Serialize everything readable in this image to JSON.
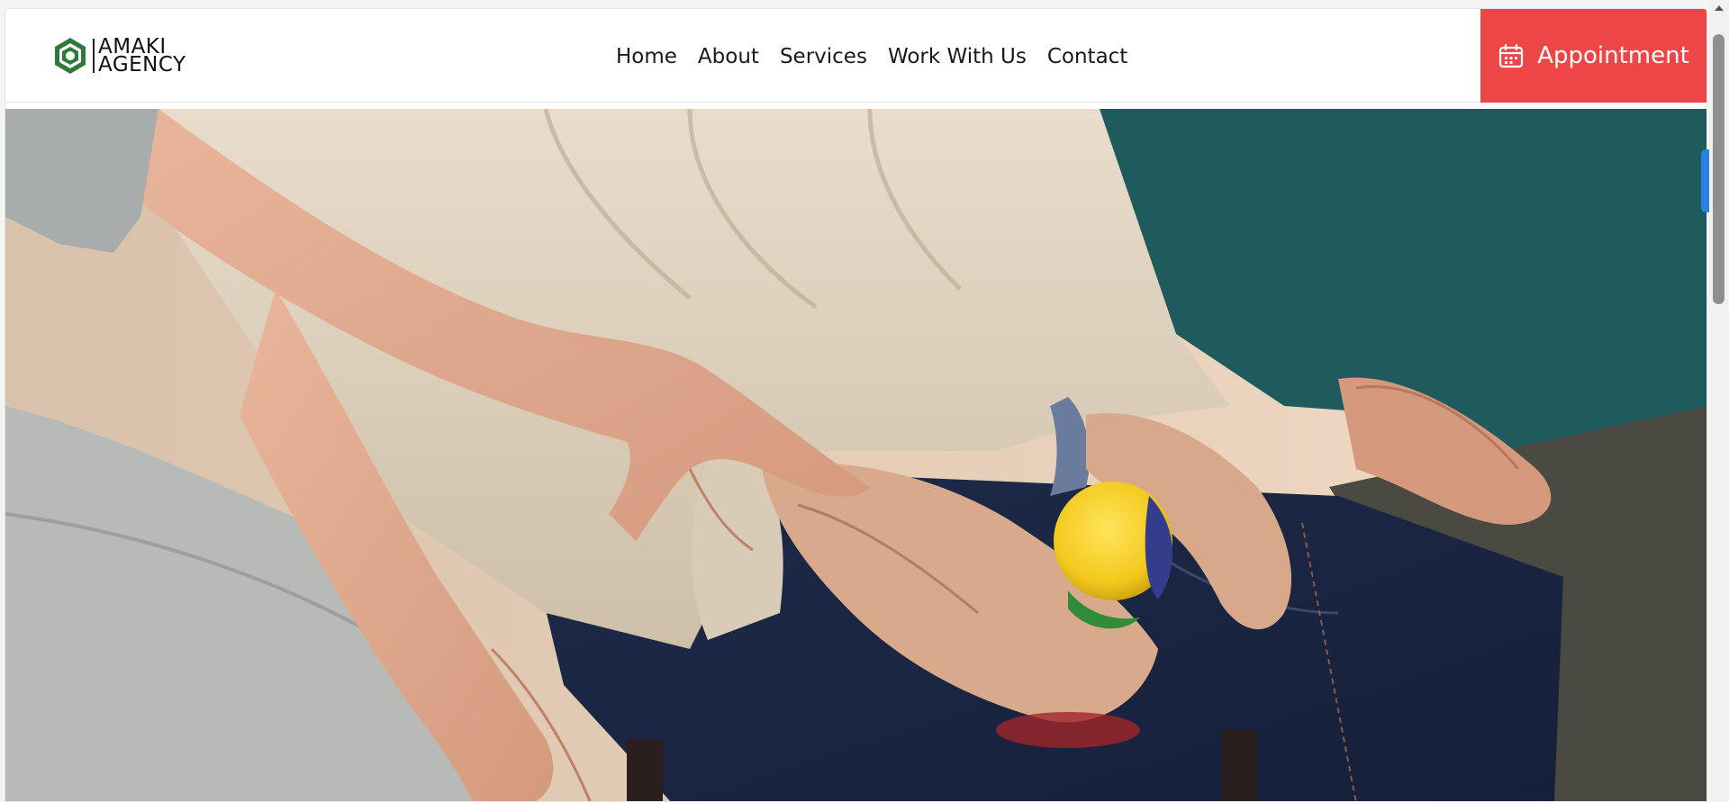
{
  "logo": {
    "line1": "AMAKI",
    "line2": "AGENCY",
    "mark_color": "#2f7a3a"
  },
  "nav": {
    "items": [
      {
        "label": "Home"
      },
      {
        "label": "About"
      },
      {
        "label": "Services"
      },
      {
        "label": "Work With Us"
      },
      {
        "label": "Contact"
      }
    ]
  },
  "cta": {
    "label": "Appointment",
    "icon": "calendar-icon",
    "color": "#ee4546"
  },
  "hero": {
    "image": "photo-elderly-hands-holding-ball"
  },
  "colors": {
    "accent": "#ee4546",
    "side_tab": "#2a7fe6"
  }
}
